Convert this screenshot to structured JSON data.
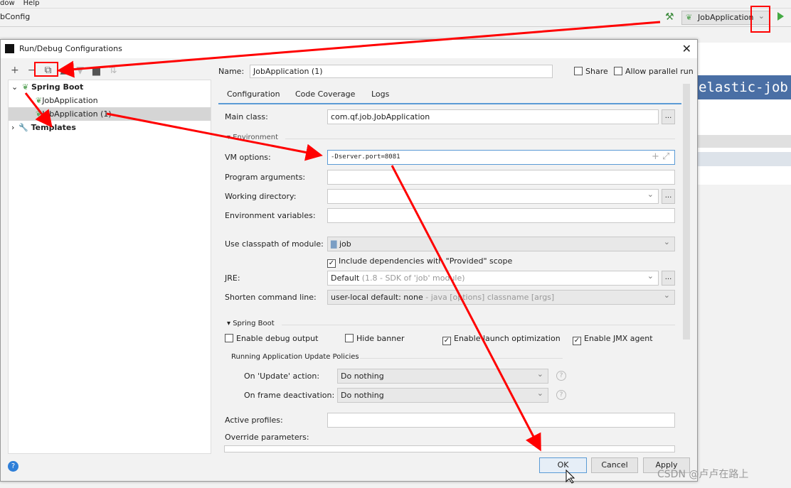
{
  "ide": {
    "menu": [
      "dow",
      "Help"
    ],
    "nav_title": "bConfig",
    "run_config": "JobApplication",
    "editor_text": "elastic-job"
  },
  "dialog": {
    "title": "Run/Debug Configurations",
    "tree": {
      "root": "Spring Boot",
      "items": [
        "JobApplication",
        "JobApplication (1)"
      ],
      "templates": "Templates"
    },
    "name_label": "Name:",
    "name_value": "JobApplication (1)",
    "share": "Share",
    "allow_parallel": "Allow parallel run",
    "tabs": [
      "Configuration",
      "Code Coverage",
      "Logs"
    ],
    "form": {
      "main_class_label": "Main class:",
      "main_class": "com.qf.job.JobApplication",
      "environment": "Environment",
      "vm_label": "VM options:",
      "vm_value": "-Dserver.port=8081",
      "program_args_label": "Program arguments:",
      "working_dir_label": "Working directory:",
      "env_vars_label": "Environment variables:",
      "classpath_label": "Use classpath of module:",
      "classpath_value": "job",
      "include_deps": "Include dependencies with \"Provided\" scope",
      "jre_label": "JRE:",
      "jre_value": "Default",
      "jre_hint": "(1.8 - SDK of 'job' module)",
      "shorten_label": "Shorten command line:",
      "shorten_value": "user-local default: none",
      "shorten_hint": "- java [options] classname [args]",
      "spring_boot": "Spring Boot",
      "debug_output": "Enable debug output",
      "hide_banner": "Hide banner",
      "launch_opt": "Enable launch optimization",
      "jmx": "Enable JMX agent",
      "policies": "Running Application Update Policies",
      "on_update_label": "On 'Update' action:",
      "on_update": "Do nothing",
      "on_frame_label": "On frame deactivation:",
      "on_frame": "Do nothing",
      "active_profiles_label": "Active profiles:",
      "override_label": "Override parameters:"
    },
    "buttons": {
      "ok": "OK",
      "cancel": "Cancel",
      "apply": "Apply"
    }
  },
  "watermark": "CSDN @卢卢在路上",
  "colors": {
    "annotation": "#ff0000",
    "focus": "#5b9bd5",
    "accent": "#4a6fa5"
  }
}
